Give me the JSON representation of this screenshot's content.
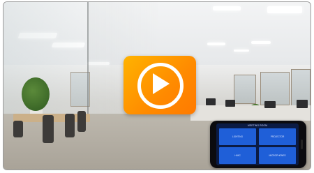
{
  "video": {
    "play_label": ""
  },
  "phone": {
    "title": "MEETING ROOM",
    "buttons": [
      {
        "label": "LIGHTING"
      },
      {
        "label": "PROJECTOR"
      },
      {
        "label": "HVAC"
      },
      {
        "label": "MICROPHONES"
      }
    ]
  },
  "colors": {
    "play_orange": "#ff9100",
    "phone_button_blue": "#1f5fd8"
  }
}
